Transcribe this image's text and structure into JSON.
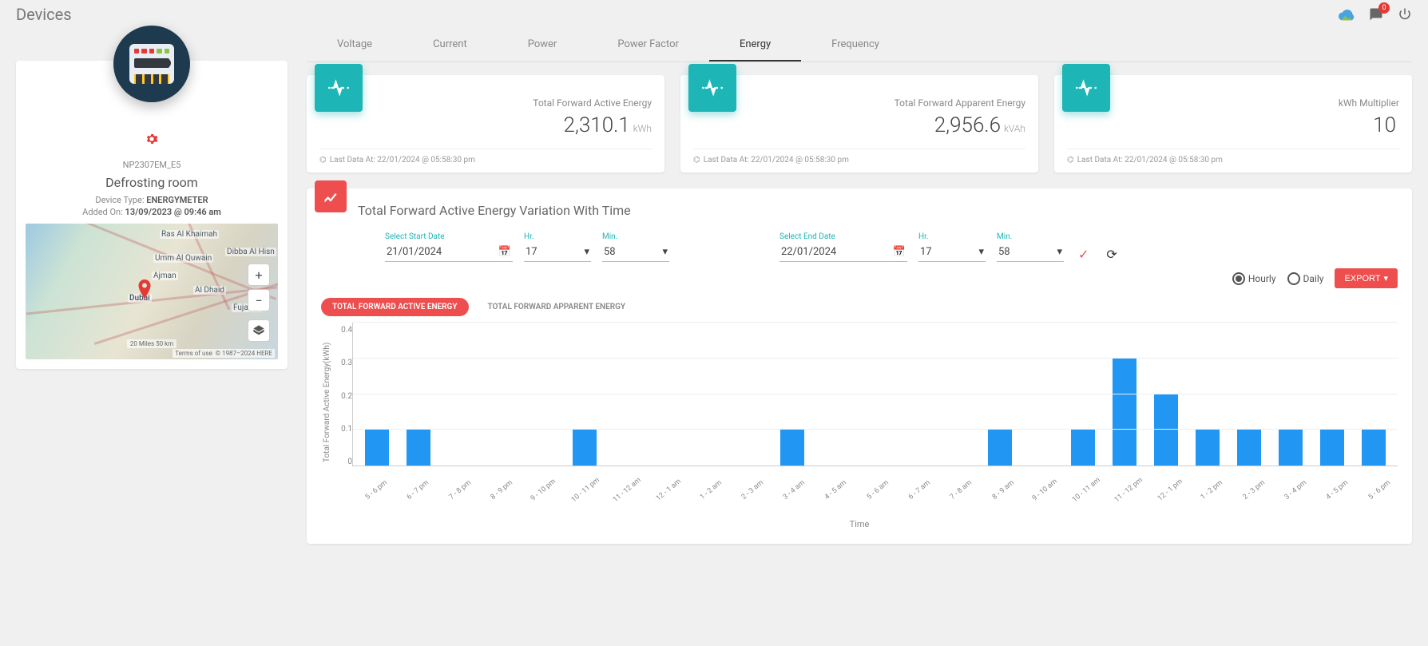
{
  "page_title": "Devices",
  "top": {
    "notification_count": "0"
  },
  "device": {
    "id": "NP2307EM_E5",
    "name": "Defrosting room",
    "type_label": "Device Type: ",
    "type_value": "ENERGYMETER",
    "added_label": "Added On: ",
    "added_value": "13/09/2023 @ 09:46 am"
  },
  "map": {
    "labels": [
      "Ras Al Khaimah",
      "Umm Al Quwain",
      "Ajman",
      "Dubai",
      "Al Dhaid",
      "Fujairah",
      "Dibba Al Hisn"
    ],
    "scale": "20 Miles   50 km",
    "attrib1": "Terms of use",
    "attrib2": "© 1987–2024 HERE"
  },
  "tabs": [
    "Voltage",
    "Current",
    "Power",
    "Power Factor",
    "Energy",
    "Frequency"
  ],
  "active_tab": 4,
  "stats": [
    {
      "label": "Total Forward Active Energy",
      "value": "2,310.1",
      "unit": "kWh",
      "foot": "Last Data At: 22/01/2024 @ 05:58:30 pm"
    },
    {
      "label": "Total Forward Apparent Energy",
      "value": "2,956.6",
      "unit": "kVAh",
      "foot": "Last Data At: 22/01/2024 @ 05:58:30 pm"
    },
    {
      "label": "kWh Multiplier",
      "value": "10",
      "unit": "",
      "foot": "Last Data At: 22/01/2024 @ 05:58:30 pm"
    }
  ],
  "chart_header": "Total Forward Active Energy Variation With Time",
  "controls": {
    "start_date_label": "Select Start Date",
    "start_date": "21/01/2024",
    "hr_label": "Hr.",
    "start_hr": "17",
    "min_label": "Min.",
    "start_min": "58",
    "end_date_label": "Select End Date",
    "end_date": "22/01/2024",
    "end_hr": "17",
    "end_min": "58",
    "hourly": "Hourly",
    "daily": "Daily",
    "export": "EXPORT"
  },
  "series_tabs": [
    "TOTAL FORWARD ACTIVE ENERGY",
    "TOTAL FORWARD APPARENT ENERGY"
  ],
  "chart_data": {
    "type": "bar",
    "title": "Total Forward Active Energy Variation With Time",
    "xlabel": "Time",
    "ylabel": "Total Forward Active Energy(kWh)",
    "ylim": [
      0,
      0.4
    ],
    "yticks": [
      0,
      0.1,
      0.2,
      0.3,
      0.4
    ],
    "categories": [
      "5 - 6 pm",
      "6 - 7 pm",
      "7 - 8 pm",
      "8 - 9 pm",
      "9 - 10 pm",
      "10 - 11 pm",
      "11 - 12 am",
      "12 - 1 am",
      "1 - 2 am",
      "2 - 3 am",
      "3 - 4 am",
      "4 - 5 am",
      "5 - 6 am",
      "6 - 7 am",
      "7 - 8 am",
      "8 - 9 am",
      "9 - 10 am",
      "10 - 11 am",
      "11 - 12 pm",
      "12 - 1 pm",
      "1 - 2 pm",
      "2 - 3 pm",
      "3 - 4 pm",
      "4 - 5 pm",
      "5 - 6 pm"
    ],
    "values": [
      0.1,
      0.1,
      0,
      0,
      0,
      0.1,
      0,
      0,
      0,
      0,
      0.1,
      0,
      0,
      0,
      0,
      0.1,
      0,
      0.1,
      0.3,
      0.2,
      0.1,
      0.1,
      0.1,
      0.1,
      0.1
    ]
  }
}
